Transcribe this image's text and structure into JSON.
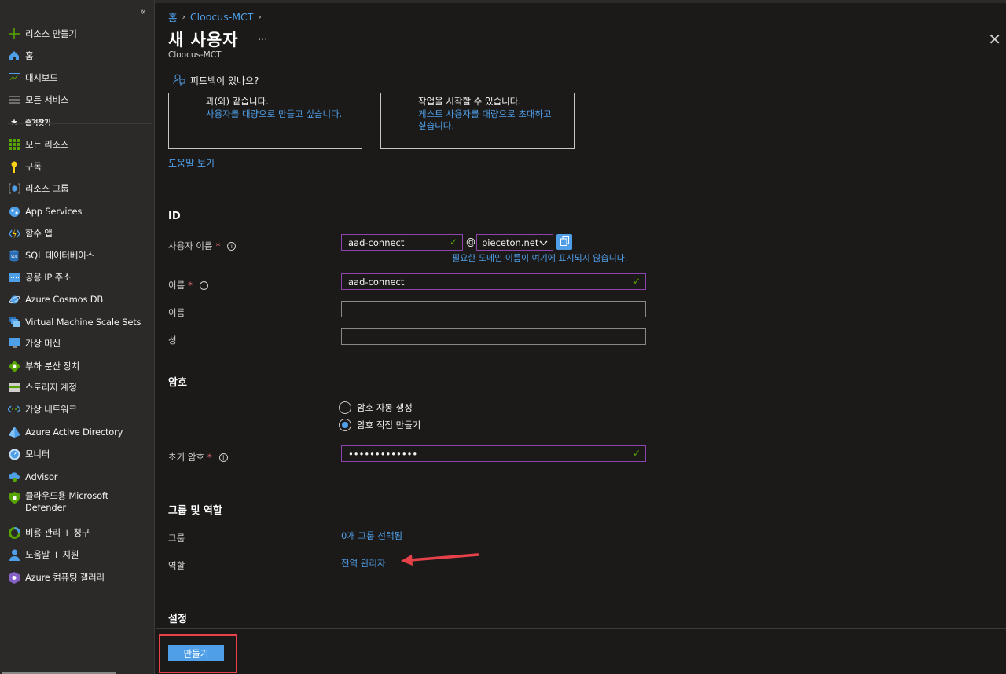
{
  "sidebar": {
    "collapse": "«",
    "items": [
      {
        "label": "리소스 만들기",
        "icon": "plus-icon",
        "color": "#57a300"
      },
      {
        "label": "홈",
        "icon": "home-icon",
        "color": "#4f9fe8"
      },
      {
        "label": "대시보드",
        "icon": "dashboard-icon",
        "color": "#4f9fe8"
      },
      {
        "label": "모든 서비스",
        "icon": "list-icon",
        "color": "#8a8886"
      },
      {
        "label": "즐겨찾기",
        "icon": "star-icon",
        "color": "#f3f2f1"
      },
      {
        "label": "모든 리소스",
        "icon": "grid-icon",
        "color": "#57a300"
      },
      {
        "label": "구독",
        "icon": "key-icon",
        "color": "#fcd116"
      },
      {
        "label": "리소스 그룹",
        "icon": "resource-group-icon",
        "color": "#4f9fe8"
      },
      {
        "label": "App Services",
        "icon": "app-services-icon",
        "color": "#4f9fe8"
      },
      {
        "label": "함수 앱",
        "icon": "function-icon",
        "color": "#fcd116"
      },
      {
        "label": "SQL 데이터베이스",
        "icon": "sql-icon",
        "color": "#4f9fe8"
      },
      {
        "label": "공용 IP 주소",
        "icon": "public-ip-icon",
        "color": "#4f9fe8"
      },
      {
        "label": "Azure Cosmos DB",
        "icon": "cosmos-icon",
        "color": "#4f9fe8"
      },
      {
        "label": "Virtual Machine Scale Sets",
        "icon": "vmss-icon",
        "color": "#4f9fe8"
      },
      {
        "label": "가상 머신",
        "icon": "vm-icon",
        "color": "#4f9fe8"
      },
      {
        "label": "부하 분산 장치",
        "icon": "load-balancer-icon",
        "color": "#57a300"
      },
      {
        "label": "스토리지 계정",
        "icon": "storage-icon",
        "color": "#57a300"
      },
      {
        "label": "가상 네트워크",
        "icon": "vnet-icon",
        "color": "#4f9fe8"
      },
      {
        "label": "Azure Active Directory",
        "icon": "aad-icon",
        "color": "#4f9fe8"
      },
      {
        "label": "모니터",
        "icon": "monitor-icon",
        "color": "#4f9fe8"
      },
      {
        "label": "Advisor",
        "icon": "advisor-icon",
        "color": "#4f9fe8"
      },
      {
        "label": "클라우드용 Microsoft Defender",
        "icon": "defender-icon",
        "color": "#57a300"
      },
      {
        "label": "비용 관리 + 청구",
        "icon": "cost-icon",
        "color": "#57a300"
      },
      {
        "label": "도움말 + 지원",
        "icon": "help-icon",
        "color": "#4f9fe8"
      },
      {
        "label": "Azure 컴퓨팅 갤러리",
        "icon": "gallery-icon",
        "color": "#8661c5"
      }
    ]
  },
  "breadcrumb": {
    "home": "홈",
    "tenant": "Cloocus-MCT"
  },
  "header": {
    "title": "새 사용자",
    "more": "...",
    "subtitle": "Cloocus-MCT",
    "close": "✕"
  },
  "feedback": "피드백이 있나요?",
  "cards": [
    {
      "text": "과(와) 같습니다.",
      "link": "사용자를 대량으로 만들고 싶습니다."
    },
    {
      "text": "작업을 시작할 수 있습니다.",
      "link": "게스트 사용자를 대량으로 초대하고 싶습니다."
    }
  ],
  "help_link": "도움말 보기",
  "identity": {
    "title": "ID",
    "username_label": "사용자 이름",
    "username_value": "aad-connect",
    "at": "@",
    "domain_value": "pieceton.net",
    "domain_hint": "필요한 도메인 이름이 여기에 표시되지 않습니다.",
    "name_label": "이름",
    "name_value": "aad-connect",
    "first_label": "이름",
    "first_value": "",
    "last_label": "성",
    "last_value": ""
  },
  "password": {
    "title": "암호",
    "auto": "암호 자동 생성",
    "manual": "암호 직접 만들기",
    "initial_label": "초기 암호",
    "initial_value": "•••••••••••••"
  },
  "groups": {
    "title": "그룹 및 역할",
    "group_label": "그룹",
    "group_value": "0개 그룹 선택됨",
    "role_label": "역할",
    "role_value": "전역 관리자"
  },
  "settings_title": "설정",
  "footer": {
    "create": "만들기"
  },
  "colors": {
    "accent": "#4f9fe8",
    "valid": "#8e44ad",
    "required": "#f1707b",
    "annotation": "#e8414a"
  }
}
